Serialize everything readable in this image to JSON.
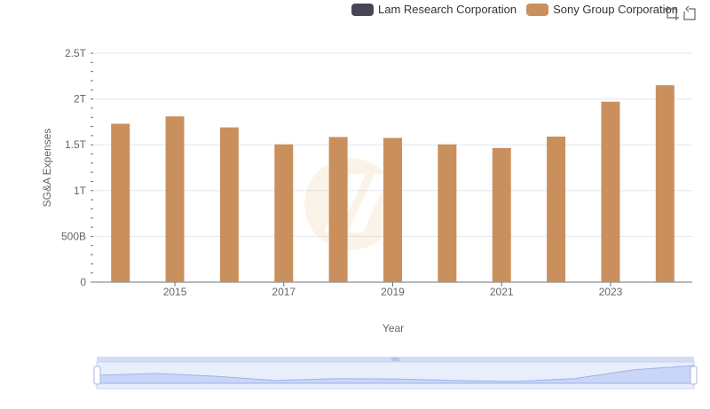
{
  "chart_data": {
    "type": "bar",
    "title": "",
    "xlabel": "Year",
    "ylabel": "SG&A Expenses",
    "x": [
      2014,
      2015,
      2016,
      2017,
      2018,
      2019,
      2020,
      2021,
      2022,
      2023,
      2024
    ],
    "x_tick_labels": [
      "2015",
      "2017",
      "2019",
      "2021",
      "2023"
    ],
    "y_tick_labels": [
      "0",
      "500B",
      "1T",
      "1.5T",
      "2T",
      "2.5T"
    ],
    "ylim": [
      0,
      2500000000000
    ],
    "grid": true,
    "legend": "top-right",
    "series": [
      {
        "name": "Lam Research Corporation",
        "color": "#464655",
        "values": [
          0,
          0,
          0,
          0,
          0,
          0,
          0,
          0,
          0,
          0,
          0
        ]
      },
      {
        "name": "Sony Group Corporation",
        "color": "#c9905e",
        "values": [
          1730000000000,
          1810000000000,
          1690000000000,
          1505000000000,
          1585000000000,
          1575000000000,
          1505000000000,
          1465000000000,
          1590000000000,
          1970000000000,
          2150000000000
        ]
      }
    ]
  },
  "toolbox": {
    "zoom_icon": "zoom-crosshair-icon",
    "restore_icon": "restore-icon"
  }
}
